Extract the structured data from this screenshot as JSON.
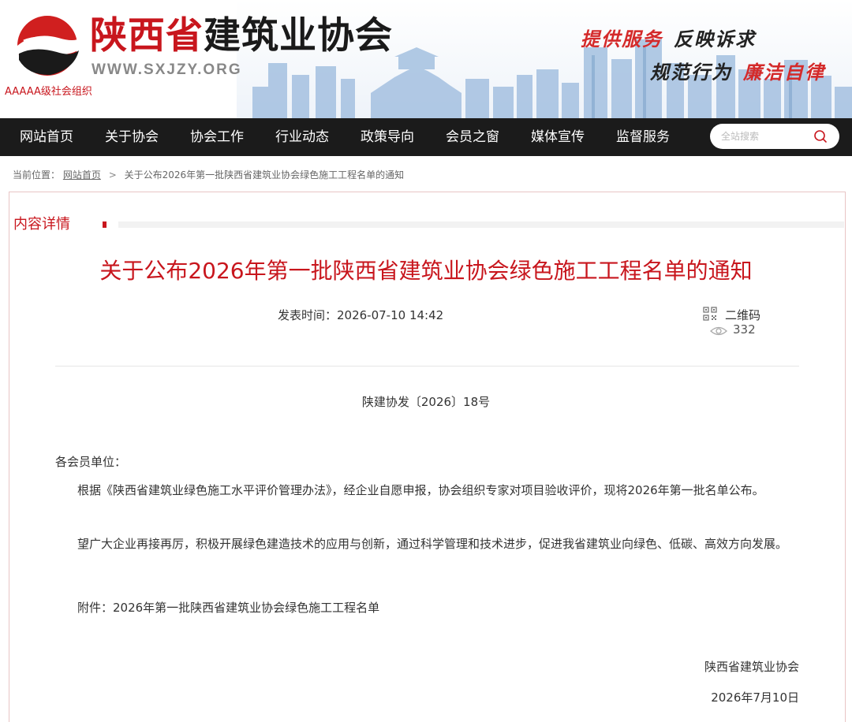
{
  "header": {
    "site_name_red": "陕西省",
    "site_name_dark": "建筑业协会",
    "site_url": "WWW.SXJZY.ORG",
    "org_level": "AAAAA级社会组织",
    "slogans": [
      "提供服务",
      "反映诉求",
      "规范行为",
      "廉洁自律"
    ]
  },
  "nav": {
    "items": [
      "网站首页",
      "关于协会",
      "协会工作",
      "行业动态",
      "政策导向",
      "会员之窗",
      "媒体宣传",
      "监督服务"
    ],
    "search_placeholder": "全站搜索"
  },
  "breadcrumb": {
    "prefix": "当前位置：",
    "home": "网站首页",
    "separator": ">",
    "current": "关于公布2026年第一批陕西省建筑业协会绿色施工工程名单的通知"
  },
  "section": {
    "title": "内容详情"
  },
  "article": {
    "title": "关于公布2026年第一批陕西省建筑业协会绿色施工工程名单的通知",
    "publish_time": "发表时间：2026-07-10 14:42",
    "qr_label": "二维码",
    "views": "332",
    "doc_number": "陕建协发〔2026〕18号",
    "salutation": "各会员单位：",
    "paragraph_1": "根据《陕西省建筑业绿色施工水平评价管理办法》，经企业自愿申报，协会组织专家对项目验收评价，现将2026年第一批名单公布。",
    "paragraph_2": "望广大企业再接再厉，积极开展绿色建造技术的应用与创新，通过科学管理和技术进步，促进我省建筑业向绿色、低碳、高效方向发展。",
    "attachment": "附件：2026年第一批陕西省建筑业协会绿色施工工程名单",
    "signature_org": "陕西省建筑业协会",
    "signature_date": "2026年7月10日"
  },
  "colors": {
    "brand_red": "#c8161d",
    "nav_bg": "#1b1b1b",
    "skyline_blue": "#8fb3d9"
  }
}
